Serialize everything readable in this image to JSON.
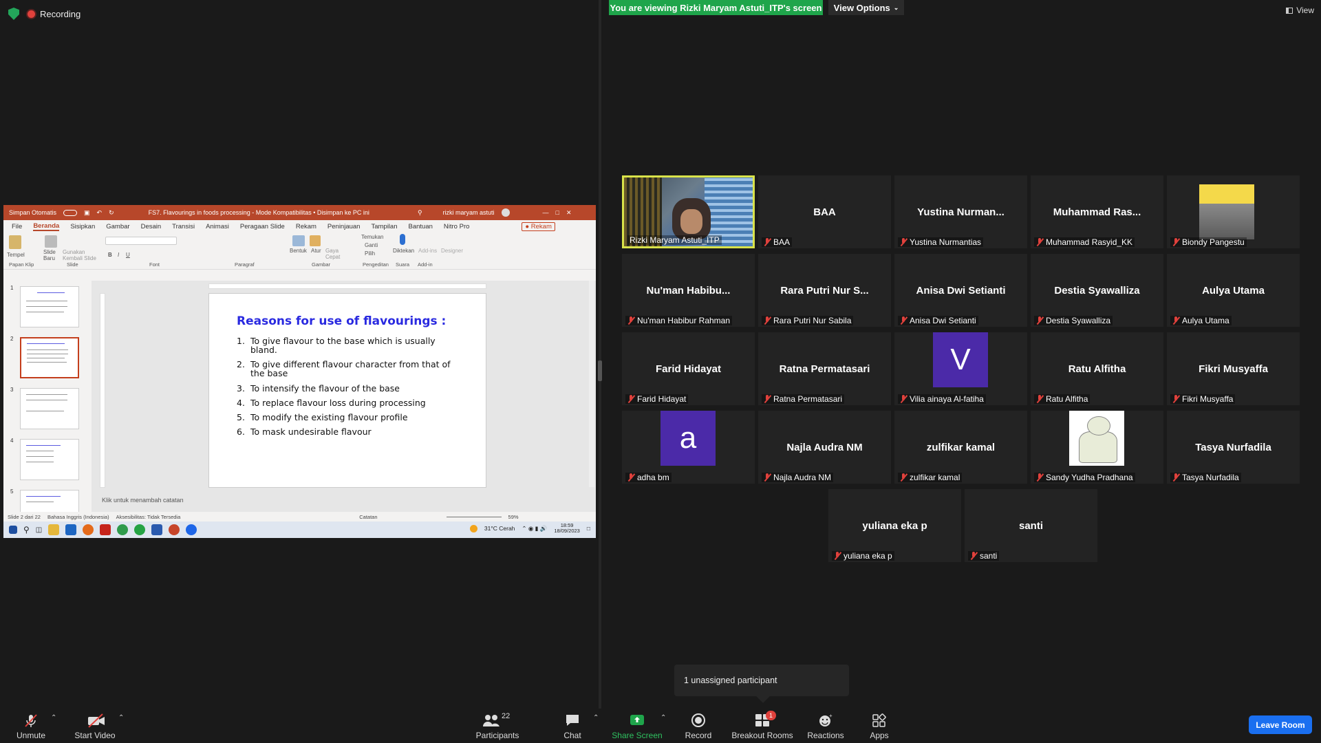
{
  "top": {
    "recording_label": "Recording",
    "viewing_banner": "You are viewing Rizki Maryam Astuti_ITP's screen",
    "view_options": "View Options",
    "view_label": "View"
  },
  "ppt": {
    "autosave": "Simpan Otomatis",
    "doc_title": "FS7. Flavourings in foods processing  -  Mode Kompatibilitas  •  Disimpan ke PC ini",
    "user": "rizki maryam astuti",
    "menu": [
      "File",
      "Beranda",
      "Sisipkan",
      "Gambar",
      "Desain",
      "Transisi",
      "Animasi",
      "Peragaan Slide",
      "Rekam",
      "Peninjauan",
      "Tampilan",
      "Bantuan",
      "Nitro Pro"
    ],
    "rekam_btn": "Rekam",
    "ribbon_groups": [
      "Papan Klip",
      "Slide",
      "Font",
      "Paragraf",
      "Gambar",
      "Pengeditan",
      "Suara",
      "Add-in"
    ],
    "ribbon_labels": {
      "tempel": "Tempel",
      "slide_baru": "Slide Baru",
      "gunakan": "Gunakan Kembali Slide",
      "bentuk": "Bentuk",
      "atur": "Atur",
      "gaya": "Gaya Cepat",
      "temukan": "Temukan",
      "ganti": "Ganti",
      "pilih": "Pilih",
      "diktekan": "Diktekan",
      "addins": "Add-ins",
      "designer": "Designer"
    },
    "slide_numbers": [
      "1",
      "2",
      "3",
      "4",
      "5"
    ],
    "slide_title": "Reasons for use of flavourings :",
    "slide_items": [
      {
        "n": "1.",
        "t": "To give flavour to the base which is usually bland."
      },
      {
        "n": "2.",
        "t": "To give different flavour character from that of the base"
      },
      {
        "n": "3.",
        "t": "To intensify the flavour of the base"
      },
      {
        "n": "4.",
        "t": "To replace flavour loss during processing"
      },
      {
        "n": "5.",
        "t": "To modify the existing flavour profile"
      },
      {
        "n": "6.",
        "t": "To mask undesirable flavour"
      }
    ],
    "notes_placeholder": "Klik untuk menambah catatan",
    "status": {
      "slide": "Slide 2 dari 22",
      "lang": "Bahasa Inggris (Indonesia)",
      "access": "Aksesibilitas: Tidak Tersedia",
      "notes": "Catatan",
      "zoom": "59%"
    },
    "taskbar": {
      "weather": "31°C Cerah",
      "time": "18:59",
      "date": "18/09/2023"
    }
  },
  "participants": [
    {
      "display": "",
      "label": "Rizki Maryam Astuti_ITP",
      "kind": "video",
      "active": true
    },
    {
      "display": "BAA",
      "label": "BAA",
      "kind": "name"
    },
    {
      "display": "Yustina  Nurman...",
      "label": "Yustina Nurmantias",
      "kind": "name"
    },
    {
      "display": "Muhammad  Ras...",
      "label": "Muhammad Rasyid_KK",
      "kind": "name"
    },
    {
      "display": "",
      "label": "Biondy Pangestu",
      "kind": "group-photo"
    },
    {
      "display": "Nu'man  Habibu...",
      "label": "Nu'man Habibur Rahman",
      "kind": "name"
    },
    {
      "display": "Rara Putri Nur S...",
      "label": "Rara Putri Nur Sabila",
      "kind": "name"
    },
    {
      "display": "Anisa Dwi Setianti",
      "label": "Anisa Dwi Setianti",
      "kind": "name"
    },
    {
      "display": "Destia Syawalliza",
      "label": "Destia Syawalliza",
      "kind": "name"
    },
    {
      "display": "Aulya Utama",
      "label": "Aulya Utama",
      "kind": "name"
    },
    {
      "display": "Farid Hidayat",
      "label": "Farid Hidayat",
      "kind": "name"
    },
    {
      "display": "Ratna Permatasari",
      "label": "Ratna Permatasari",
      "kind": "name"
    },
    {
      "display": "V",
      "label": "Vilia ainaya Al-fatiha",
      "kind": "avatar",
      "color": "#4b2aa8"
    },
    {
      "display": "Ratu Alfitha",
      "label": "Ratu Alfitha",
      "kind": "name"
    },
    {
      "display": "Fikri Musyaffa",
      "label": "Fikri Musyaffa",
      "kind": "name"
    },
    {
      "display": "a",
      "label": "adha bm",
      "kind": "avatar",
      "color": "#4b2aa8"
    },
    {
      "display": "Najla Audra NM",
      "label": "Najla Audra NM",
      "kind": "name"
    },
    {
      "display": "zulfikar kamal",
      "label": "zulfikar kamal",
      "kind": "name"
    },
    {
      "display": "",
      "label": "Sandy Yudha Pradhana",
      "kind": "bear"
    },
    {
      "display": "Tasya Nurfadila",
      "label": "Tasya Nurfadila",
      "kind": "name"
    },
    {
      "display": "yuliana eka p",
      "label": "yuliana eka p",
      "kind": "name"
    },
    {
      "display": "santi",
      "label": "santi",
      "kind": "name"
    }
  ],
  "popup": {
    "unassigned": "1 unassigned participant"
  },
  "toolbar": {
    "unmute": "Unmute",
    "start_video": "Start Video",
    "participants": "Participants",
    "participants_count": "22",
    "chat": "Chat",
    "share_screen": "Share Screen",
    "record": "Record",
    "breakout": "Breakout Rooms",
    "breakout_badge": "1",
    "reactions": "Reactions",
    "apps": "Apps",
    "leave": "Leave Room"
  },
  "colors": {
    "share_green": "#1fa54b",
    "active_border": "#d9e34a",
    "leave_blue": "#1a6ff0",
    "muted_red": "#e0413c",
    "ppt_accent": "#b7472a"
  }
}
